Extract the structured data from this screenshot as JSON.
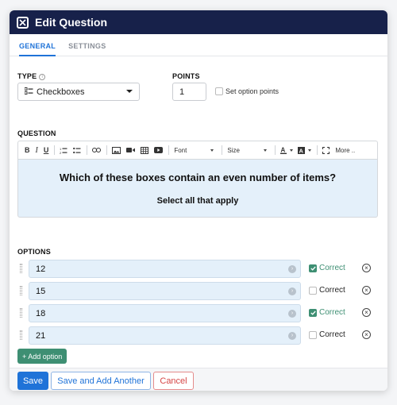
{
  "header": {
    "title": "Edit Question"
  },
  "tabs": [
    {
      "label": "GENERAL",
      "active": true
    },
    {
      "label": "SETTINGS",
      "active": false
    }
  ],
  "type": {
    "label": "TYPE",
    "value": "Checkboxes"
  },
  "points": {
    "label": "POINTS",
    "value": "1",
    "set_option_points_label": "Set option points"
  },
  "question": {
    "label": "QUESTION",
    "toolbar": {
      "font": "Font",
      "size": "Size",
      "more": "More .."
    },
    "line1": "Which of these boxes contain an even number of items?",
    "line2": "Select all that apply"
  },
  "options": {
    "label": "OPTIONS",
    "correct_label": "Correct",
    "items": [
      {
        "value": "12",
        "correct": true
      },
      {
        "value": "15",
        "correct": false
      },
      {
        "value": "18",
        "correct": true
      },
      {
        "value": "21",
        "correct": false
      }
    ],
    "add_label": "+ Add option"
  },
  "footer": {
    "save": "Save",
    "save_add": "Save and Add Another",
    "cancel": "Cancel"
  },
  "colors": {
    "header_bg": "#17214a",
    "primary": "#1f73d8",
    "success": "#3e8f73",
    "danger": "#d64545"
  }
}
